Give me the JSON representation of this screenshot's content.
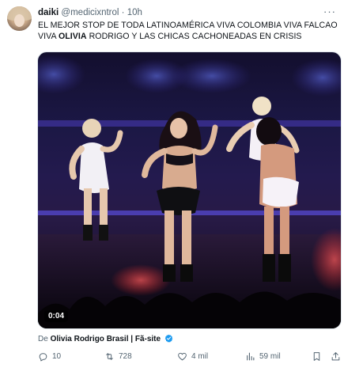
{
  "tweet": {
    "display_name": "daiki",
    "handle": "@medicixntrol",
    "separator": "·",
    "time": "10h",
    "text_part1": "EL MEJOR STOP DE TODA LATINOAMÉRICA VIVA COLOMBIA VIVA FALCAO VIVA ",
    "text_bold": "OLIVIA",
    "text_part2": " RODRIGO Y LAS CHICAS CACHONEADAS EN CRISIS",
    "more_label": "···"
  },
  "media": {
    "video_time": "0:04"
  },
  "source": {
    "prefix": "De",
    "name": "Olivia Rodrigo Brasil | Fã-site"
  },
  "actions": {
    "replies": "10",
    "retweets": "728",
    "likes": "4 mil",
    "views": "59 mil"
  },
  "colors": {
    "text_primary": "#0f1419",
    "text_secondary": "#536471",
    "verified_blue": "#1d9bf0",
    "stage_purple": "#3b2fa8"
  },
  "icons": [
    "reply-icon",
    "retweet-icon",
    "like-icon",
    "views-icon",
    "bookmark-icon",
    "share-icon",
    "verified-icon",
    "more-icon"
  ]
}
